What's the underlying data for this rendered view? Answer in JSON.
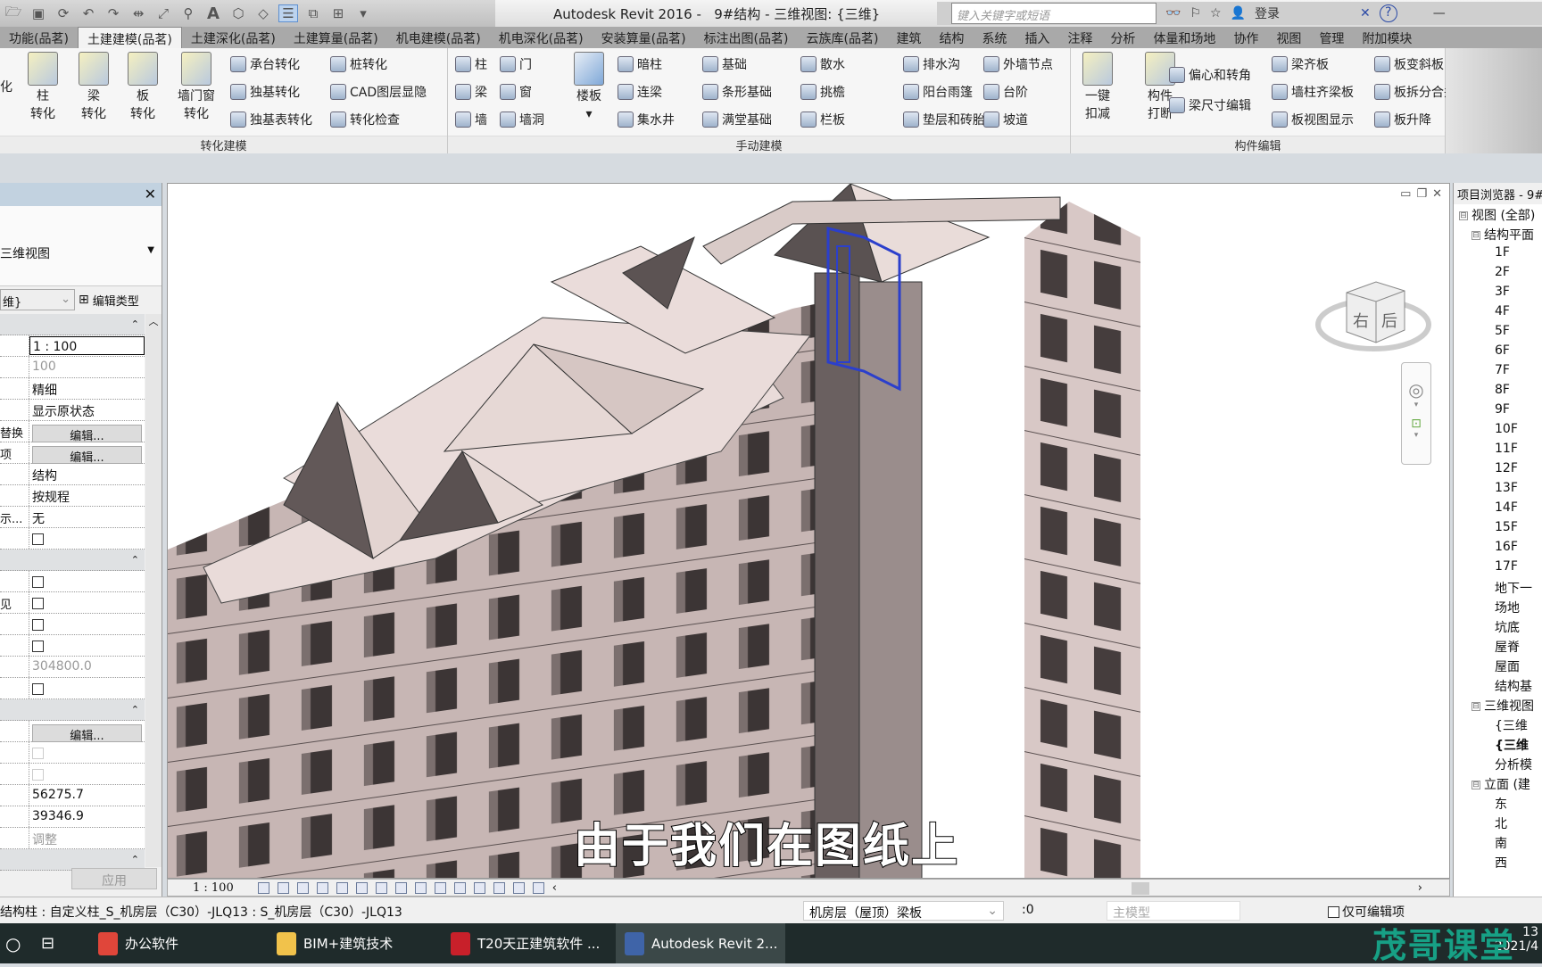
{
  "title": {
    "app": "Autodesk Revit 2016 -",
    "doc": "9#结构 - 三维视图: {三维}"
  },
  "search": {
    "placeholder": "键入关键字或短语",
    "login": "登录"
  },
  "tabs": [
    "功能(品茗)",
    "土建建模(品茗)",
    "土建深化(品茗)",
    "土建算量(品茗)",
    "机电建模(品茗)",
    "机电深化(品茗)",
    "安装算量(品茗)",
    "标注出图(品茗)",
    "云族库(品茗)",
    "建筑",
    "结构",
    "系统",
    "插入",
    "注释",
    "分析",
    "体量和场地",
    "协作",
    "视图",
    "管理",
    "附加模块"
  ],
  "active_tab": 1,
  "ribbon": {
    "convert": {
      "label": "转化建模",
      "partial": "化",
      "big": [
        {
          "l1": "柱",
          "l2": "转化"
        },
        {
          "l1": "梁",
          "l2": "转化"
        },
        {
          "l1": "板",
          "l2": "转化"
        },
        {
          "l1": "墙门窗",
          "l2": "转化"
        }
      ],
      "small": [
        "承台转化",
        "独基转化",
        "独基表转化",
        "桩转化",
        "CAD图层显隐",
        "转化检查"
      ]
    },
    "manual": {
      "label": "手动建模",
      "floor": "楼板",
      "small": [
        "柱",
        "梁",
        "墙",
        "门",
        "窗",
        "墙洞",
        "暗柱",
        "连梁",
        "集水井",
        "基础",
        "条形基础",
        "满堂基础",
        "散水",
        "挑檐",
        "栏板",
        "排水沟",
        "阳台雨篷",
        "垫层和砖胎膜",
        "外墙节点",
        "台阶",
        "坡道"
      ]
    },
    "edit": {
      "label": "构件编辑",
      "big": [
        {
          "l1": "一键",
          "l2": "扣减"
        },
        {
          "l1": "构件",
          "l2": "打断"
        }
      ],
      "small": [
        "偏心和转角",
        "梁尺寸编辑",
        "梁齐板",
        "墙柱齐梁板",
        "板视图显示",
        "板变斜板",
        "板拆分合并",
        "板升降"
      ]
    }
  },
  "properties": {
    "type": "三维视图",
    "instance": "维}",
    "edit_type": "编辑类型",
    "rows": [
      {
        "kind": "hdr"
      },
      {
        "label": "",
        "value": "1 : 100",
        "boxed": true
      },
      {
        "label": "",
        "value": "100",
        "grey": true
      },
      {
        "label": "",
        "value": "精细"
      },
      {
        "label": "",
        "value": "显示原状态"
      },
      {
        "label": "替换",
        "button": "编辑..."
      },
      {
        "label": "项",
        "button": "编辑..."
      },
      {
        "label": "",
        "value": "结构"
      },
      {
        "label": "",
        "value": "按规程"
      },
      {
        "label": "示...",
        "value": "无"
      },
      {
        "label": "",
        "check": true
      },
      {
        "kind": "hdr"
      },
      {
        "label": "",
        "check": true
      },
      {
        "label": "见",
        "check": true
      },
      {
        "label": "",
        "check": true
      },
      {
        "label": "",
        "check": true
      },
      {
        "label": "",
        "value": "304800.0",
        "grey": true
      },
      {
        "label": "",
        "check": true
      },
      {
        "kind": "hdr"
      },
      {
        "label": "",
        "button": "编辑..."
      },
      {
        "label": "",
        "check": true,
        "disabled": true
      },
      {
        "label": "",
        "check": true,
        "disabled": true
      },
      {
        "label": "",
        "value": "56275.7"
      },
      {
        "label": "",
        "value": "39346.9"
      },
      {
        "label": "",
        "value": "调整",
        "grey": true
      },
      {
        "kind": "hdr"
      }
    ],
    "apply": "应用"
  },
  "viewport": {
    "subtitle": "由于我们在图纸上",
    "scale": "1 : 100",
    "viewcube": {
      "left": "右",
      "right": "后"
    }
  },
  "browser": {
    "title": "项目浏览器 - 9#",
    "items": [
      {
        "t": "视图 (全部)",
        "lvl": 0,
        "tw": "⊟"
      },
      {
        "t": "结构平面",
        "lvl": 1,
        "tw": "⊟"
      },
      {
        "t": "1F",
        "lvl": 2
      },
      {
        "t": "2F",
        "lvl": 2
      },
      {
        "t": "3F",
        "lvl": 2
      },
      {
        "t": "4F",
        "lvl": 2
      },
      {
        "t": "5F",
        "lvl": 2
      },
      {
        "t": "6F",
        "lvl": 2
      },
      {
        "t": "7F",
        "lvl": 2
      },
      {
        "t": "8F",
        "lvl": 2
      },
      {
        "t": "9F",
        "lvl": 2
      },
      {
        "t": "10F",
        "lvl": 2
      },
      {
        "t": "11F",
        "lvl": 2
      },
      {
        "t": "12F",
        "lvl": 2
      },
      {
        "t": "13F",
        "lvl": 2
      },
      {
        "t": "14F",
        "lvl": 2
      },
      {
        "t": "15F",
        "lvl": 2
      },
      {
        "t": "16F",
        "lvl": 2
      },
      {
        "t": "17F",
        "lvl": 2
      },
      {
        "t": "地下一",
        "lvl": 2
      },
      {
        "t": "场地",
        "lvl": 2
      },
      {
        "t": "坑底",
        "lvl": 2
      },
      {
        "t": "屋脊",
        "lvl": 2
      },
      {
        "t": "屋面",
        "lvl": 2
      },
      {
        "t": "结构基",
        "lvl": 2
      },
      {
        "t": "三维视图",
        "lvl": 1,
        "tw": "⊟"
      },
      {
        "t": "{三维",
        "lvl": 2
      },
      {
        "t": "{三维",
        "lvl": 2,
        "bold": true
      },
      {
        "t": "分析模",
        "lvl": 2
      },
      {
        "t": "立面 (建",
        "lvl": 1,
        "tw": "⊟"
      },
      {
        "t": "东",
        "lvl": 2
      },
      {
        "t": "北",
        "lvl": 2
      },
      {
        "t": "南",
        "lvl": 2
      },
      {
        "t": "西",
        "lvl": 2
      }
    ]
  },
  "status": {
    "text": "结构柱 : 自定义柱_S_机房层（C30）-JLQ13 : S_机房层（C30）-JLQ13",
    "workset": "机房层（屋顶）梁板",
    "count": ":0",
    "model": "主模型",
    "editable_only": "仅可编辑项"
  },
  "taskbar": {
    "items": [
      {
        "label": "办公软件",
        "color": "#e0463a"
      },
      {
        "label": "BIM+建筑技术",
        "color": "#f1c24b"
      },
      {
        "label": "T20天正建筑软件 ...",
        "color": "#c8202a"
      },
      {
        "label": "Autodesk Revit 2...",
        "color": "#3f64a8"
      }
    ],
    "time": "13",
    "date": "2021/4",
    "watermark": "茂哥课堂"
  }
}
